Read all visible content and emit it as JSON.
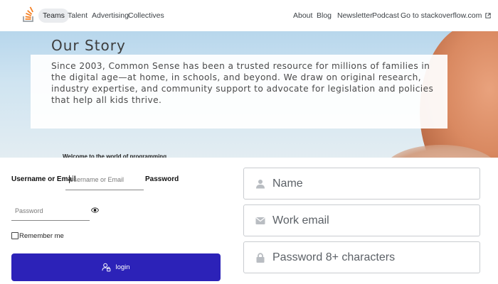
{
  "nav": {
    "left": [
      "Teams",
      "Talent",
      "Advertising",
      "Collectives"
    ],
    "right": [
      "About",
      "Blog",
      "Newsletter",
      "Podcast",
      "Go to stackoverflow.com"
    ],
    "active": "Teams",
    "accent": "#f48024"
  },
  "hero": {
    "title": "Our Story",
    "body": "Since 2003, Common Sense has been a trusted resource for millions of families in the digital age—at home, in schools, and beyond. We draw on original research, industry expertise, and community support to advocate for legislation and policies that help all kids thrive."
  },
  "login": {
    "welcome": "Welcome to the world of programming",
    "username_label": "Username or Email",
    "username_placeholder": "Username or Email",
    "password_label": "Password",
    "password_placeholder": "Password",
    "remember_label": "Remember me",
    "login_button": "login",
    "button_color": "#2c22b8"
  },
  "signup": {
    "name_placeholder": "Name",
    "email_placeholder": "Work email",
    "password_placeholder": "Password 8+ characters"
  }
}
